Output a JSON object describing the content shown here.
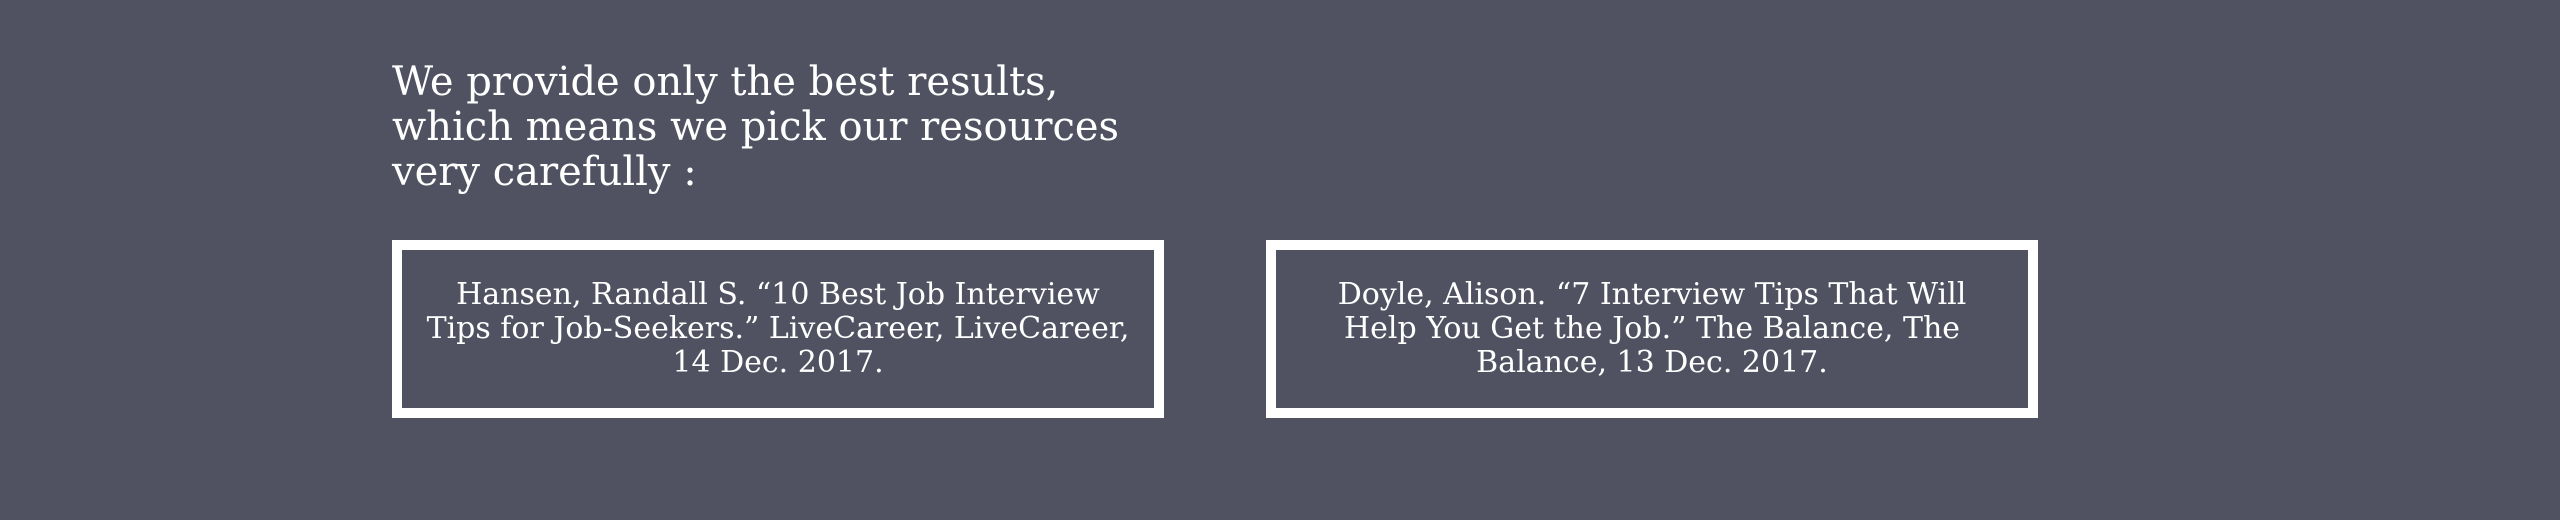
{
  "intro_text": "We provide only the best results, which means we pick our resources very carefully :",
  "sources": [
    {
      "citation": "Hansen, Randall S. “10 Best Job Interview Tips for Job-Seekers.” LiveCareer, LiveCareer, 14 Dec. 2017."
    },
    {
      "citation": "Doyle, Alison. “7 Interview Tips That Will Help You Get the Job.” The Balance, The Balance, 13 Dec. 2017."
    }
  ],
  "colors": {
    "background": "#505261",
    "text": "#ffffff",
    "border": "#ffffff"
  }
}
